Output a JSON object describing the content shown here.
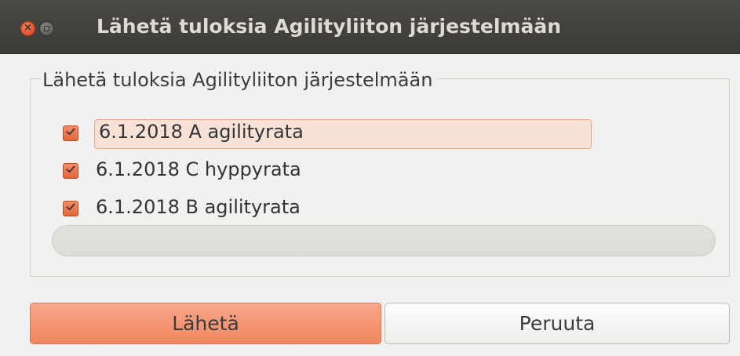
{
  "window": {
    "title": "Lähetä tuloksia Agilityliiton järjestelmään"
  },
  "group": {
    "legend": "Lähetä tuloksia Agilityliiton järjestelmään",
    "items": [
      {
        "label": "6.1.2018 A agilityrata",
        "checked": true,
        "focused": true
      },
      {
        "label": "6.1.2018 C hyppyrata",
        "checked": true,
        "focused": false
      },
      {
        "label": "6.1.2018 B agilityrata",
        "checked": true,
        "focused": false
      }
    ],
    "progress": 0
  },
  "buttons": {
    "send_label": "Lähetä",
    "cancel_label": "Peruuta"
  },
  "colors": {
    "accent": "#f08760",
    "titlebar": "#3c3b37",
    "window_bg": "#f2f1f0"
  },
  "icons": {
    "close": "close-icon",
    "minimize": "minimize-icon",
    "check": "checkmark-icon"
  }
}
